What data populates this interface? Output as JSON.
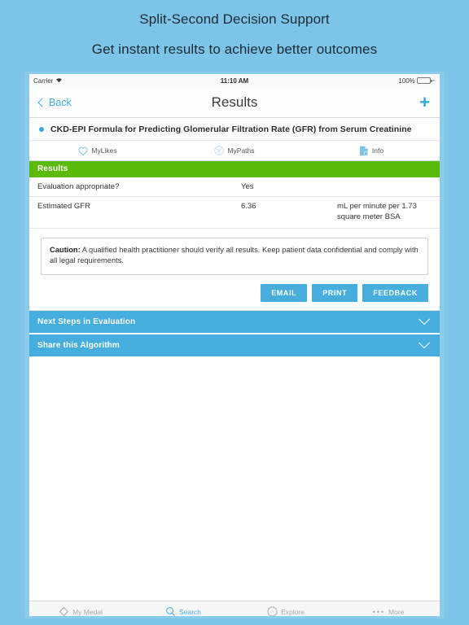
{
  "promo": {
    "line1": "Split-Second Decision Support",
    "line2": "Get instant results to achieve better outcomes"
  },
  "status_bar": {
    "carrier": "Carrier",
    "wifi_icon": "wifi-icon",
    "time": "11:10 AM",
    "battery_percent": "100%",
    "battery_icon": "battery-icon"
  },
  "navbar": {
    "back_label": "Back",
    "title": "Results",
    "add_label": "+"
  },
  "algorithm": {
    "title": "CKD-EPI Formula for Predicting Glomerular Filtration Rate (GFR) from Serum Creatinine"
  },
  "action_row": [
    {
      "label": "MyLikes",
      "icon": "heart-icon"
    },
    {
      "label": "MyPaths",
      "icon": "paths-icon"
    },
    {
      "label": "Info",
      "icon": "info-document-icon"
    }
  ],
  "results": {
    "header": "Results",
    "rows": [
      {
        "label": "Evaluation appropriate?",
        "value": "Yes",
        "units": ""
      },
      {
        "label": "Estimated GFR",
        "value": "6.36",
        "units": "mL per minute per 1.73 square meter BSA"
      }
    ]
  },
  "caution": {
    "prefix": "Caution:",
    "text": " A qualified health practitioner should verify all results. Keep patient data confidential and comply with all legal requirements."
  },
  "buttons": [
    {
      "label": "EMAIL",
      "name": "email-button"
    },
    {
      "label": "PRINT",
      "name": "print-button"
    },
    {
      "label": "FEEDBACK",
      "name": "feedback-button"
    }
  ],
  "accordions": [
    {
      "label": "Next Steps in Evaluation",
      "icon": "chevron-down-icon"
    },
    {
      "label": "Share this Algorithm",
      "icon": "chevron-down-icon"
    }
  ],
  "tabbar": [
    {
      "label": "My Medal",
      "icon": "diamond-icon",
      "active": false
    },
    {
      "label": "Search",
      "icon": "search-icon",
      "active": true
    },
    {
      "label": "Explore",
      "icon": "compass-icon",
      "active": false
    },
    {
      "label": "More",
      "icon": "ellipsis-icon",
      "active": false
    }
  ],
  "colors": {
    "background": "#7cc5e8",
    "accent_blue": "#46aede",
    "results_green": "#5cbb0a",
    "link_blue": "#41add4",
    "battery_green": "#4cd362"
  }
}
